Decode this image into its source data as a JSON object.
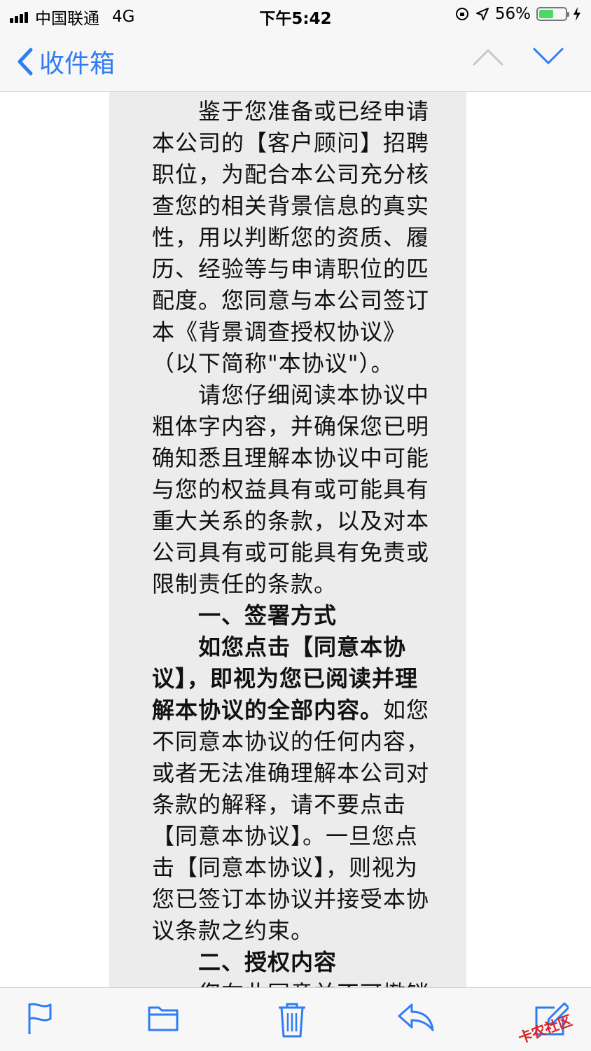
{
  "status_bar": {
    "carrier": "中国联通",
    "network": "4G",
    "time": "下午5:42",
    "battery_percent": "56%",
    "battery_level": 0.56
  },
  "nav": {
    "back_label": "收件箱",
    "up_icon": "chevron-up-icon",
    "down_icon": "chevron-down-icon"
  },
  "email": {
    "p1": "鉴于您准备或已经申请本公司的【客户顾问】招聘职位，为配合本公司充分核查您的相关背景信息的真实性，用以判断您的资质、履历、经验等与申请职位的匹配度。您同意与本公司签订本《背景调查授权协议》（以下简称\"本协议\"）。",
    "p2": "请您仔细阅读本协议中粗体字内容，并确保您已明确知悉且理解本协议中可能与您的权益具有或可能具有重大关系的条款，以及对本公司具有或可能具有免责或限制责任的条款。",
    "h1": "一、签署方式",
    "p3_bold": "如您点击【同意本协议】，即视为您已阅读并理解本协议的全部内容。",
    "p3_rest": "如您不同意本协议的任何内容，或者无法准确理解本公司对条款的解释，请不要点击【同意本协议】。一旦您点击【同意本协议】，则视为您已签订本协议并接受本协议条款之约束。",
    "h2": "二、授权内容",
    "p4": "您在此同意并不可撤销"
  },
  "toolbar": {
    "items": [
      "flag-icon",
      "folder-icon",
      "trash-icon",
      "reply-icon",
      "compose-icon"
    ]
  },
  "watermark": "卡农社区",
  "colors": {
    "accent": "#2f7cf6",
    "battery": "#4cd964"
  }
}
